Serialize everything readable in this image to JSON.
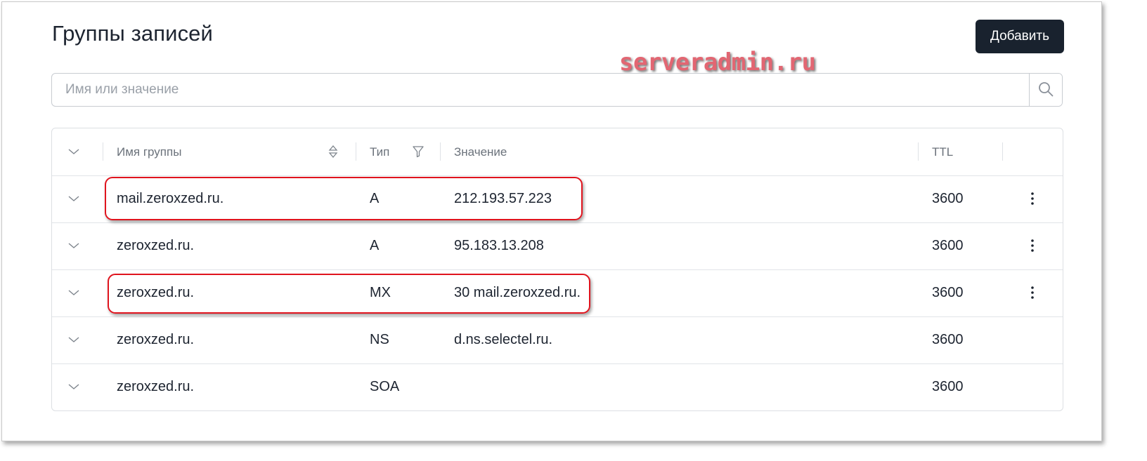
{
  "page": {
    "title": "Группы записей",
    "add_label": "Добавить"
  },
  "watermark": "serveradmin.ru",
  "search": {
    "placeholder": "Имя или значение",
    "value": ""
  },
  "table": {
    "headers": {
      "name": "Имя группы",
      "type": "Тип",
      "value": "Значение",
      "ttl": "TTL"
    },
    "rows": [
      {
        "name": "mail.zeroxzed.ru.",
        "type": "A",
        "value": "212.193.57.223",
        "ttl": "3600",
        "has_menu": true
      },
      {
        "name": "zeroxzed.ru.",
        "type": "A",
        "value": "95.183.13.208",
        "ttl": "3600",
        "has_menu": true
      },
      {
        "name": "zeroxzed.ru.",
        "type": "MX",
        "value": "30 mail.zeroxzed.ru.",
        "ttl": "3600",
        "has_menu": true
      },
      {
        "name": "zeroxzed.ru.",
        "type": "NS",
        "value": "d.ns.selectel.ru.",
        "ttl": "3600",
        "has_menu": false
      },
      {
        "name": "zeroxzed.ru.",
        "type": "SOA",
        "value": "",
        "ttl": "3600",
        "has_menu": false
      }
    ]
  },
  "icons": {
    "search": "search-icon",
    "expand": "chevron-down-icon",
    "sort": "sort-icon",
    "filter": "filter-icon",
    "menu": "more-vertical-icon"
  },
  "colors": {
    "primary_button": "#19222e",
    "highlight": "#e0141e",
    "watermark": "#e26672"
  }
}
